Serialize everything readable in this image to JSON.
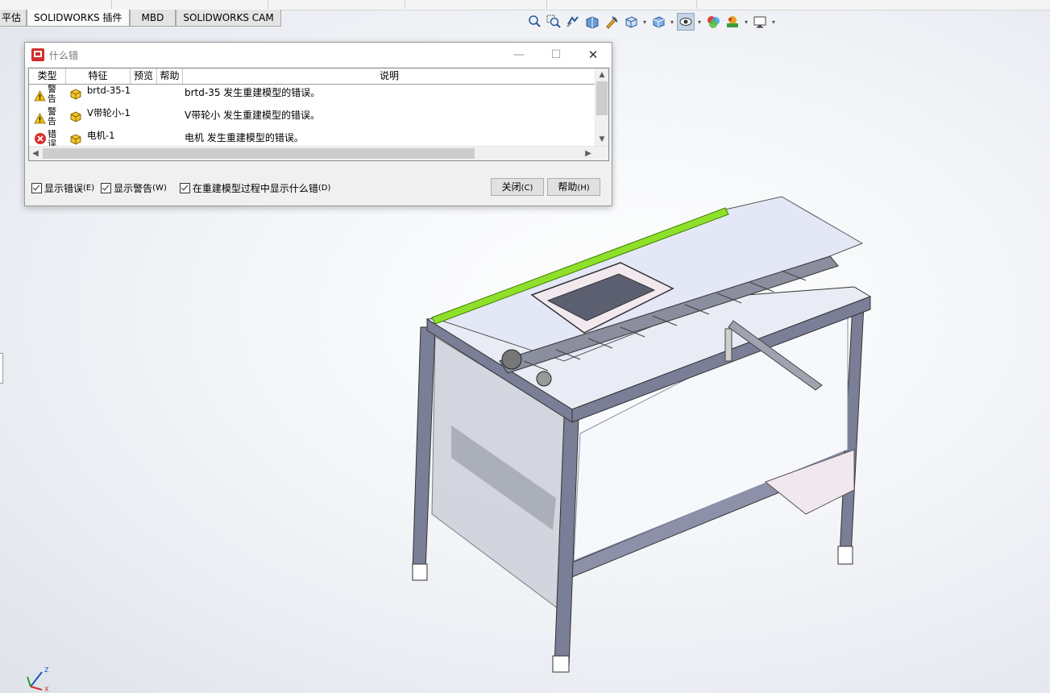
{
  "command_tabs": [
    {
      "label": "平估",
      "active": false
    },
    {
      "label": "SOLIDWORKS 插件",
      "active": true
    },
    {
      "label": "MBD",
      "active": false
    },
    {
      "label": "SOLIDWORKS CAM",
      "active": false
    }
  ],
  "heads_up_toolbar": {
    "icons": [
      "zoom-to-fit-icon",
      "zoom-area-icon",
      "previous-view-icon",
      "section-view-icon",
      "dynamic-annotation-icon",
      "view-orientation-icon",
      "display-style-icon",
      "hide-show-items-icon",
      "edit-appearance-icon",
      "apply-scene-icon",
      "view-settings-icon"
    ]
  },
  "dialog": {
    "title": "什么错",
    "columns": [
      "类型",
      "特征",
      "预览",
      "帮助",
      "说明"
    ],
    "rows": [
      {
        "type": "警告",
        "status_icon": "warning-icon",
        "feature": "brtd-35-1",
        "description": "brtd-35 发生重建模型的错误。"
      },
      {
        "type": "警告",
        "status_icon": "warning-icon",
        "feature": "V带轮小-1",
        "description": "V带轮小 发生重建模型的错误。"
      },
      {
        "type": "错误",
        "status_icon": "error-icon",
        "feature": "电机-1",
        "description": "电机 发生重建模型的错误。"
      }
    ],
    "checkboxes": [
      {
        "label": "显示错误",
        "shortcut": "(E)",
        "checked": true
      },
      {
        "label": "显示警告",
        "shortcut": "(W)",
        "checked": true
      },
      {
        "label": "在重建模型过程中显示什么错",
        "shortcut": "(D)",
        "checked": true
      }
    ],
    "buttons": {
      "close": "关闭",
      "close_key": "(C)",
      "help": "帮助",
      "help_key": "(H)"
    }
  },
  "triad": {
    "x": "X",
    "y": "Y",
    "z": "Z"
  },
  "colors": {
    "accent_green": "#8ee02a",
    "frame": "#7a7e96",
    "warning": "#f5c400",
    "error": "#d9302c"
  }
}
